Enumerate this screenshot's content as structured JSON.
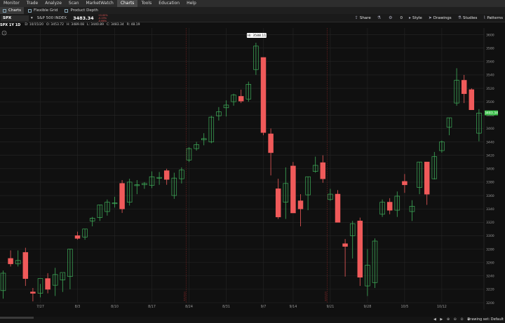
{
  "menu": [
    "Monitor",
    "Trade",
    "Analyze",
    "Scan",
    "MarketWatch",
    "Charts",
    "Tools",
    "Education",
    "Help"
  ],
  "menu_active": "Charts",
  "subtabs": [
    "Charts",
    "Flexible Grid",
    "Product Depth"
  ],
  "toolbar": {
    "symbol": "SPX",
    "description": "S&P 500 INDEX",
    "price": "3483.34",
    "change": [
      "+0.00%",
      "-0.19%",
      "-0.66%"
    ],
    "right": {
      "share": "Share",
      "zero": "0",
      "style": "Style",
      "drawings": "Drawings",
      "studies": "Studies",
      "patterns": "Patterns"
    }
  },
  "study": {
    "title": "SPX 1Y 1D",
    "items": [
      "D: 10/15/20",
      "O: 3453.72",
      "H: 3489.08",
      "L: 3440.89",
      "C: 3483.34",
      "R: 48.19"
    ]
  },
  "colors": {
    "up": "#3fae5a",
    "down": "#f05a5a",
    "grid": "#262626",
    "price_tag": "#3bc14a"
  },
  "chart_data": {
    "type": "candlestick",
    "ylim": [
      3200,
      3610
    ],
    "y_ticks": [
      3200,
      3220,
      3240,
      3260,
      3280,
      3300,
      3320,
      3340,
      3360,
      3380,
      3400,
      3420,
      3440,
      3460,
      3480,
      3500,
      3520,
      3540,
      3560,
      3580,
      3600
    ],
    "x_labels": [
      {
        "i": 5,
        "label": "7/27"
      },
      {
        "i": 10,
        "label": "8/3"
      },
      {
        "i": 15,
        "label": "8/10"
      },
      {
        "i": 20,
        "label": "8/17"
      },
      {
        "i": 25,
        "label": "8/24"
      },
      {
        "i": 30,
        "label": "8/31"
      },
      {
        "i": 35,
        "label": "9/7"
      },
      {
        "i": 39,
        "label": "9/14"
      },
      {
        "i": 44,
        "label": "9/21"
      },
      {
        "i": 49,
        "label": "9/28"
      },
      {
        "i": 54,
        "label": "10/5"
      },
      {
        "i": 59,
        "label": "10/12"
      }
    ],
    "vlines": [
      {
        "i": 24.6,
        "label": "7/17/20"
      },
      {
        "i": 43.6,
        "label": "9/21/20"
      }
    ],
    "hi_label": "Hi: 3588.11",
    "last_price": "3483.34",
    "candles": [
      {
        "o": 3218,
        "h": 3248,
        "l": 3206,
        "c": 3244
      },
      {
        "o": 3266,
        "h": 3278,
        "l": 3254,
        "c": 3258
      },
      {
        "o": 3258,
        "h": 3278,
        "l": 3254,
        "c": 3263
      },
      {
        "o": 3275,
        "h": 3282,
        "l": 3225,
        "c": 3236
      },
      {
        "o": 3216,
        "h": 3222,
        "l": 3202,
        "c": 3214
      },
      {
        "o": 3214,
        "h": 3228,
        "l": 3208,
        "c": 3236
      },
      {
        "o": 3236,
        "h": 3244,
        "l": 3214,
        "c": 3220
      },
      {
        "o": 3226,
        "h": 3252,
        "l": 3210,
        "c": 3242
      },
      {
        "o": 3234,
        "h": 3244,
        "l": 3216,
        "c": 3245
      },
      {
        "o": 3239,
        "h": 3280,
        "l": 3220,
        "c": 3280
      },
      {
        "o": 3300,
        "h": 3306,
        "l": 3294,
        "c": 3296
      },
      {
        "o": 3298,
        "h": 3310,
        "l": 3294,
        "c": 3310
      },
      {
        "o": 3322,
        "h": 3328,
        "l": 3314,
        "c": 3326
      },
      {
        "o": 3327,
        "h": 3346,
        "l": 3322,
        "c": 3346
      },
      {
        "o": 3336,
        "h": 3354,
        "l": 3330,
        "c": 3350
      },
      {
        "o": 3349,
        "h": 3358,
        "l": 3342,
        "c": 3349
      },
      {
        "o": 3378,
        "h": 3383,
        "l": 3334,
        "c": 3340
      },
      {
        "o": 3350,
        "h": 3385,
        "l": 3345,
        "c": 3380
      },
      {
        "o": 3376,
        "h": 3383,
        "l": 3362,
        "c": 3376
      },
      {
        "o": 3376,
        "h": 3380,
        "l": 3370,
        "c": 3378
      },
      {
        "o": 3375,
        "h": 3396,
        "l": 3371,
        "c": 3388
      },
      {
        "o": 3387,
        "h": 3395,
        "l": 3376,
        "c": 3387
      },
      {
        "o": 3397,
        "h": 3400,
        "l": 3376,
        "c": 3384
      },
      {
        "o": 3360,
        "h": 3394,
        "l": 3355,
        "c": 3386
      },
      {
        "o": 3385,
        "h": 3402,
        "l": 3378,
        "c": 3398
      },
      {
        "o": 3413,
        "h": 3432,
        "l": 3410,
        "c": 3430
      },
      {
        "o": 3430,
        "h": 3440,
        "l": 3427,
        "c": 3436
      },
      {
        "o": 3443,
        "h": 3453,
        "l": 3435,
        "c": 3445
      },
      {
        "o": 3440,
        "h": 3479,
        "l": 3438,
        "c": 3477
      },
      {
        "o": 3479,
        "h": 3492,
        "l": 3472,
        "c": 3485
      },
      {
        "o": 3491,
        "h": 3502,
        "l": 3478,
        "c": 3495
      },
      {
        "o": 3500,
        "h": 3512,
        "l": 3494,
        "c": 3510
      },
      {
        "o": 3508,
        "h": 3518,
        "l": 3498,
        "c": 3501
      },
      {
        "o": 3504,
        "h": 3530,
        "l": 3500,
        "c": 3526
      },
      {
        "o": 3548,
        "h": 3588,
        "l": 3540,
        "c": 3583
      },
      {
        "o": 3566,
        "h": 3566,
        "l": 3450,
        "c": 3454
      },
      {
        "o": 3452,
        "h": 3460,
        "l": 3390,
        "c": 3424
      },
      {
        "o": 3370,
        "h": 3385,
        "l": 3325,
        "c": 3328
      },
      {
        "o": 3350,
        "h": 3402,
        "l": 3325,
        "c": 3378
      },
      {
        "o": 3404,
        "h": 3410,
        "l": 3335,
        "c": 3334
      },
      {
        "o": 3352,
        "h": 3362,
        "l": 3314,
        "c": 3340
      },
      {
        "o": 3361,
        "h": 3388,
        "l": 3338,
        "c": 3388
      },
      {
        "o": 3396,
        "h": 3418,
        "l": 3394,
        "c": 3405
      },
      {
        "o": 3409,
        "h": 3420,
        "l": 3379,
        "c": 3385
      },
      {
        "o": 3354,
        "h": 3370,
        "l": 3352,
        "c": 3362
      },
      {
        "o": 3362,
        "h": 3368,
        "l": 3320,
        "c": 3320
      },
      {
        "o": 3288,
        "h": 3295,
        "l": 3239,
        "c": 3284
      },
      {
        "o": 3300,
        "h": 3322,
        "l": 3266,
        "c": 3318
      },
      {
        "o": 3322,
        "h": 3327,
        "l": 3225,
        "c": 3238
      },
      {
        "o": 3225,
        "h": 3280,
        "l": 3210,
        "c": 3256
      },
      {
        "o": 3230,
        "h": 3296,
        "l": 3222,
        "c": 3292
      },
      {
        "o": 3332,
        "h": 3354,
        "l": 3328,
        "c": 3350
      },
      {
        "o": 3350,
        "h": 3356,
        "l": 3332,
        "c": 3338
      },
      {
        "o": 3338,
        "h": 3366,
        "l": 3328,
        "c": 3359
      },
      {
        "o": 3381,
        "h": 3392,
        "l": 3364,
        "c": 3376
      },
      {
        "o": 3336,
        "h": 3353,
        "l": 3322,
        "c": 3344
      },
      {
        "o": 3372,
        "h": 3410,
        "l": 3362,
        "c": 3410
      },
      {
        "o": 3410,
        "h": 3410,
        "l": 3346,
        "c": 3362
      },
      {
        "o": 3385,
        "h": 3425,
        "l": 3384,
        "c": 3418
      },
      {
        "o": 3427,
        "h": 3442,
        "l": 3424,
        "c": 3440
      },
      {
        "o": 3462,
        "h": 3476,
        "l": 3450,
        "c": 3476
      },
      {
        "o": 3498,
        "h": 3550,
        "l": 3494,
        "c": 3532
      },
      {
        "o": 3532,
        "h": 3540,
        "l": 3498,
        "c": 3512
      },
      {
        "o": 3518,
        "h": 3520,
        "l": 3490,
        "c": 3488
      },
      {
        "o": 3453,
        "h": 3489,
        "l": 3441,
        "c": 3483
      }
    ]
  },
  "bottom": {
    "drawing_set": "Drawing set: Default",
    "icons": "◀ ▶ ⊕ ⊖ ⊙ ◈"
  }
}
